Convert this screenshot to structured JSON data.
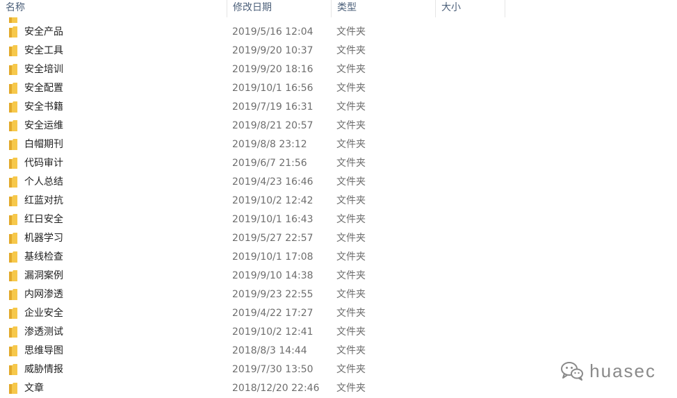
{
  "columns": {
    "name": "名称",
    "date": "修改日期",
    "type": "类型",
    "size": "大小"
  },
  "partial_row": {
    "fragment_left": "",
    "fragment_right": "",
    "icon": "folder-icon"
  },
  "files": [
    {
      "name": "安全产品",
      "date": "2019/5/16 12:04",
      "type": "文件夹",
      "icon": "folder-icon"
    },
    {
      "name": "安全工具",
      "date": "2019/9/20 10:37",
      "type": "文件夹",
      "icon": "folder-icon"
    },
    {
      "name": "安全培训",
      "date": "2019/9/20 18:16",
      "type": "文件夹",
      "icon": "folder-icon"
    },
    {
      "name": "安全配置",
      "date": "2019/10/1 16:56",
      "type": "文件夹",
      "icon": "folder-icon"
    },
    {
      "name": "安全书籍",
      "date": "2019/7/19 16:31",
      "type": "文件夹",
      "icon": "folder-icon"
    },
    {
      "name": "安全运维",
      "date": "2019/8/21 20:57",
      "type": "文件夹",
      "icon": "folder-icon"
    },
    {
      "name": "白帽期刊",
      "date": "2019/8/8 23:12",
      "type": "文件夹",
      "icon": "folder-icon"
    },
    {
      "name": "代码审计",
      "date": "2019/6/7 21:56",
      "type": "文件夹",
      "icon": "folder-icon"
    },
    {
      "name": "个人总结",
      "date": "2019/4/23 16:46",
      "type": "文件夹",
      "icon": "folder-icon"
    },
    {
      "name": "红蓝对抗",
      "date": "2019/10/2 12:42",
      "type": "文件夹",
      "icon": "folder-icon"
    },
    {
      "name": "红日安全",
      "date": "2019/10/1 16:43",
      "type": "文件夹",
      "icon": "folder-icon"
    },
    {
      "name": "机器学习",
      "date": "2019/5/27 22:57",
      "type": "文件夹",
      "icon": "folder-icon"
    },
    {
      "name": "基线检查",
      "date": "2019/10/1 17:08",
      "type": "文件夹",
      "icon": "folder-icon"
    },
    {
      "name": "漏洞案例",
      "date": "2019/9/10 14:38",
      "type": "文件夹",
      "icon": "folder-icon"
    },
    {
      "name": "内网渗透",
      "date": "2019/9/23 22:55",
      "type": "文件夹",
      "icon": "folder-icon"
    },
    {
      "name": "企业安全",
      "date": "2019/4/22 17:27",
      "type": "文件夹",
      "icon": "folder-icon"
    },
    {
      "name": "渗透测试",
      "date": "2019/10/2 12:41",
      "type": "文件夹",
      "icon": "folder-icon"
    },
    {
      "name": "思维导图",
      "date": "2018/8/3 14:44",
      "type": "文件夹",
      "icon": "folder-icon"
    },
    {
      "name": "威胁情报",
      "date": "2019/7/30 13:50",
      "type": "文件夹",
      "icon": "folder-icon"
    },
    {
      "name": "文章",
      "date": "2018/12/20 22:46",
      "type": "文件夹",
      "icon": "folder-icon"
    }
  ],
  "watermark": {
    "text": "huasec",
    "icon": "wechat-icon"
  },
  "colors": {
    "folder": "#f6c84b",
    "folder_shade": "#e2a92b",
    "header_text": "#4c607a",
    "secondary_text": "#6d6d6d"
  }
}
